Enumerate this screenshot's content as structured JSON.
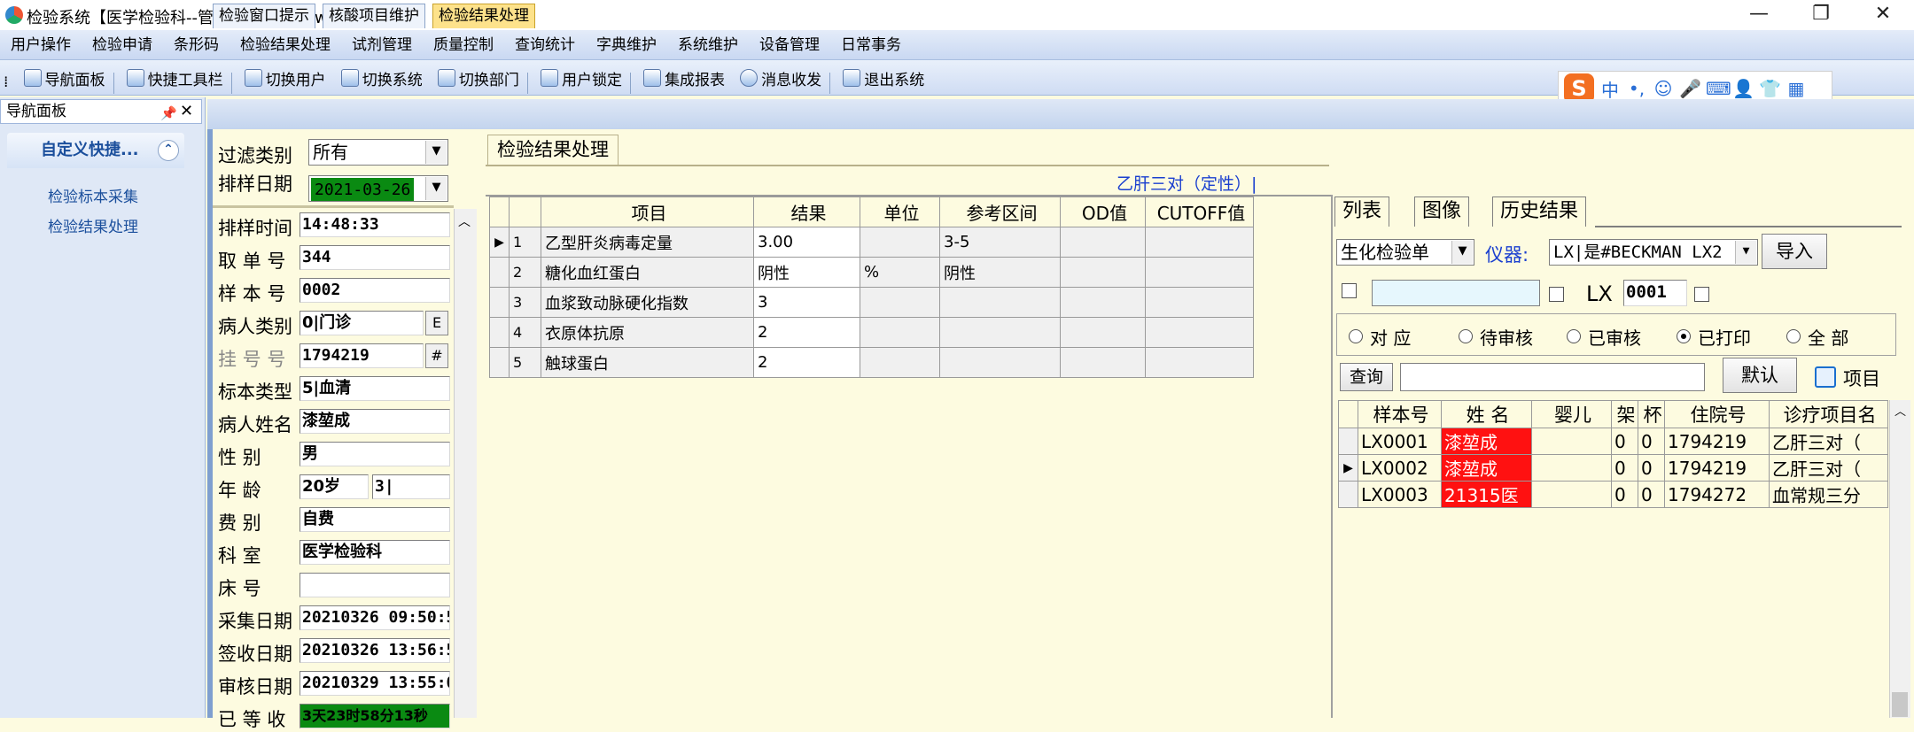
{
  "window": {
    "title": "检验系统【医学检验科--管理员】---【newsrmyy】",
    "min": "—",
    "restore": "❐",
    "close": "✕"
  },
  "menu": [
    "用户操作",
    "检验申请",
    "条形码",
    "检验结果处理",
    "试剂管理",
    "质量控制",
    "查询统计",
    "字典维护",
    "系统维护",
    "设备管理",
    "日常事务"
  ],
  "toolbar": [
    "导航面板",
    "快捷工具栏",
    "切换用户",
    "切换系统",
    "切换部门",
    "用户锁定",
    "集成报表",
    "消息收发",
    "退出系统"
  ],
  "ime": {
    "logo": "S",
    "lang": "中",
    "punct": "•,",
    "icons": [
      "☺",
      "🎤",
      "⌨",
      "👤",
      "👕",
      "▦"
    ]
  },
  "nav": {
    "header": "导航面板",
    "pin": "📌",
    "close": "✕",
    "group": "自定义快捷...",
    "group_toggle": "⌃",
    "links": [
      "检验标本采集",
      "检验结果处理"
    ]
  },
  "doc_tabs": [
    "检验窗口提示",
    "核酸项目维护",
    "检验结果处理"
  ],
  "form": {
    "filter_label": "过滤类别",
    "filter_value": "所有",
    "sort_date_label": "排样日期",
    "sort_date_value": "2021-03-26",
    "fields": [
      {
        "label": "排样时间",
        "value": "14:48:33"
      },
      {
        "label": "取 单 号",
        "value": "344"
      },
      {
        "label": "样 本 号",
        "value": "0002"
      },
      {
        "label": "病人类别",
        "value": "0|门诊",
        "btn": "E"
      },
      {
        "label": "挂 号 号",
        "value": "1794219",
        "btn": "#"
      },
      {
        "label": "标本类型",
        "value": "5|血清"
      },
      {
        "label": "病人姓名",
        "value": "漆堃成"
      },
      {
        "label": "性    别",
        "value": "男"
      },
      {
        "label": "年    龄",
        "value": "20岁",
        "value2": "3|"
      },
      {
        "label": "费    别",
        "value": "自费"
      },
      {
        "label": "科    室",
        "value": "医学检验科"
      },
      {
        "label": "床    号",
        "value": ""
      },
      {
        "label": "采集日期",
        "value": "20210326 09:50:5"
      },
      {
        "label": "签收日期",
        "value": "20210326 13:56:5"
      },
      {
        "label": "审核日期",
        "value": "20210329 13:55:0"
      },
      {
        "label": "已 等 收",
        "value": "3天23时58分13秒"
      }
    ]
  },
  "results": {
    "panel_tab": "检验结果处理",
    "title": "乙肝三对（定性）|",
    "headers": [
      "项目",
      "结果",
      "单位",
      "参考区间",
      "OD值",
      "CUTOFF值"
    ],
    "rows": [
      {
        "n": "1",
        "item": "乙型肝炎病毒定量",
        "result": "3.00",
        "unit": "",
        "ref": "3-5",
        "od": "",
        "cutoff": ""
      },
      {
        "n": "2",
        "item": "糖化血红蛋白",
        "result": "阴性",
        "unit": "%",
        "ref": "阴性",
        "od": "",
        "cutoff": ""
      },
      {
        "n": "3",
        "item": "血浆致动脉硬化指数",
        "result": "3",
        "unit": "",
        "ref": "",
        "od": "",
        "cutoff": ""
      },
      {
        "n": "4",
        "item": "衣原体抗原",
        "result": "2",
        "unit": "",
        "ref": "",
        "od": "",
        "cutoff": ""
      },
      {
        "n": "5",
        "item": "触球蛋白",
        "result": "2",
        "unit": "",
        "ref": "",
        "od": "",
        "cutoff": ""
      }
    ]
  },
  "right": {
    "tabs": [
      "列表",
      "图像",
      "历史结果"
    ],
    "sheet_type": "生化检验单",
    "instrument_label": "仪器:",
    "instrument_value": "LX|是#BECKMAN LX2",
    "import_btn": "导入",
    "lx_label": "LX",
    "lx_value": "0001",
    "radios": [
      "对 应",
      "待审核",
      "已审核",
      "已打印",
      "全 部"
    ],
    "radio_selected": 3,
    "query_btn": "查询",
    "default_btn": "默认",
    "project_btn": "项目",
    "list_headers": [
      "样本号",
      "姓 名",
      "婴儿",
      "架",
      "杯",
      "住院号",
      "诊疗项目名"
    ],
    "list_rows": [
      {
        "id": "LX0001",
        "name": "漆堃成",
        "baby": "",
        "rack": "0",
        "cup": "0",
        "inpatient": "1794219",
        "proj": "乙肝三对（"
      },
      {
        "id": "LX0002",
        "name": "漆堃成",
        "baby": "",
        "rack": "0",
        "cup": "0",
        "inpatient": "1794219",
        "proj": "乙肝三对（"
      },
      {
        "id": "LX0003",
        "name": "21315医",
        "baby": "",
        "rack": "0",
        "cup": "0",
        "inpatient": "1794272",
        "proj": "血常规三分"
      }
    ],
    "colors": {
      "name_highlight": "#ff1111",
      "link_blue": "#1a3fcf"
    }
  }
}
